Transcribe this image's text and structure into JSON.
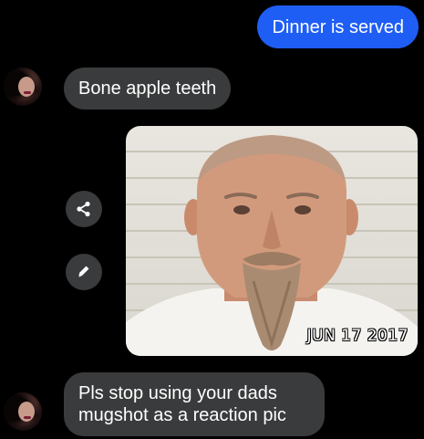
{
  "messages": {
    "sent_1": "Dinner is served",
    "received_1": "Bone apple teeth",
    "received_2": "Pls stop using your dads mugshot as a reaction pic"
  },
  "photo": {
    "date_stamp": "JUN 17 2017"
  },
  "actions": {
    "share_icon": "share-icon",
    "edit_icon": "pencil-icon"
  },
  "colors": {
    "background": "#000000",
    "sent_bubble": "#1f5ef5",
    "received_bubble": "#3a3b3c",
    "text": "#ffffff"
  }
}
